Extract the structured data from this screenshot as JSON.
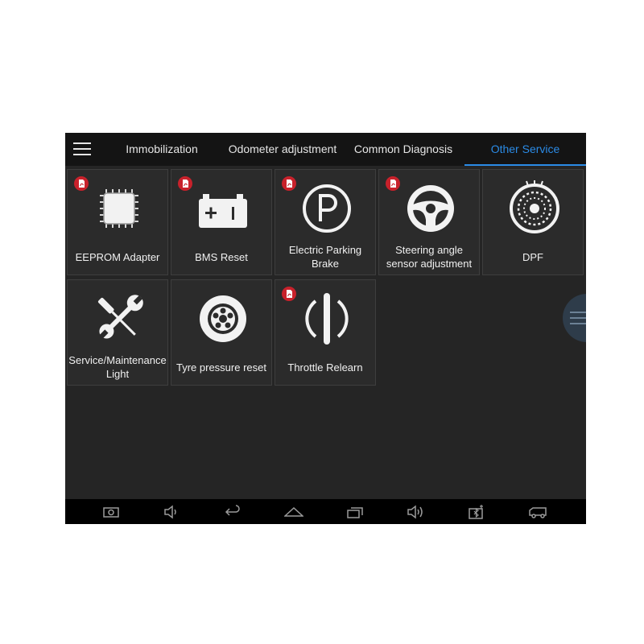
{
  "tabs": [
    {
      "label": "Immobilization"
    },
    {
      "label": "Odometer adjustment"
    },
    {
      "label": "Common Diagnosis"
    },
    {
      "label": "Other Service"
    }
  ],
  "active_tab": "Other Service",
  "tiles": [
    {
      "label": "EEPROM Adapter",
      "icon": "chip-icon",
      "pdf": true
    },
    {
      "label": "BMS Reset",
      "icon": "battery-icon",
      "pdf": true
    },
    {
      "label": "Electric Parking Brake",
      "icon": "parking-brake-icon",
      "pdf": true
    },
    {
      "label": "Steering angle sensor adjustment",
      "icon": "steering-wheel-icon",
      "pdf": true
    },
    {
      "label": "DPF",
      "icon": "dpf-filter-icon",
      "pdf": false
    },
    {
      "label": "Service/Maintenance Light",
      "icon": "wrench-screwdriver-icon",
      "pdf": false
    },
    {
      "label": "Tyre pressure reset",
      "icon": "tyre-icon",
      "pdf": false
    },
    {
      "label": "Throttle Relearn",
      "icon": "throttle-icon",
      "pdf": true
    }
  ],
  "nav_buttons": [
    "screenshot-icon",
    "volume-down-icon",
    "back-icon",
    "home-icon",
    "recent-apps-icon",
    "volume-up-icon",
    "bluetooth-icon",
    "vehicle-icon"
  ],
  "colors": {
    "accent": "#2b8be6",
    "pdf_badge": "#c8212b",
    "background": "#252525"
  }
}
